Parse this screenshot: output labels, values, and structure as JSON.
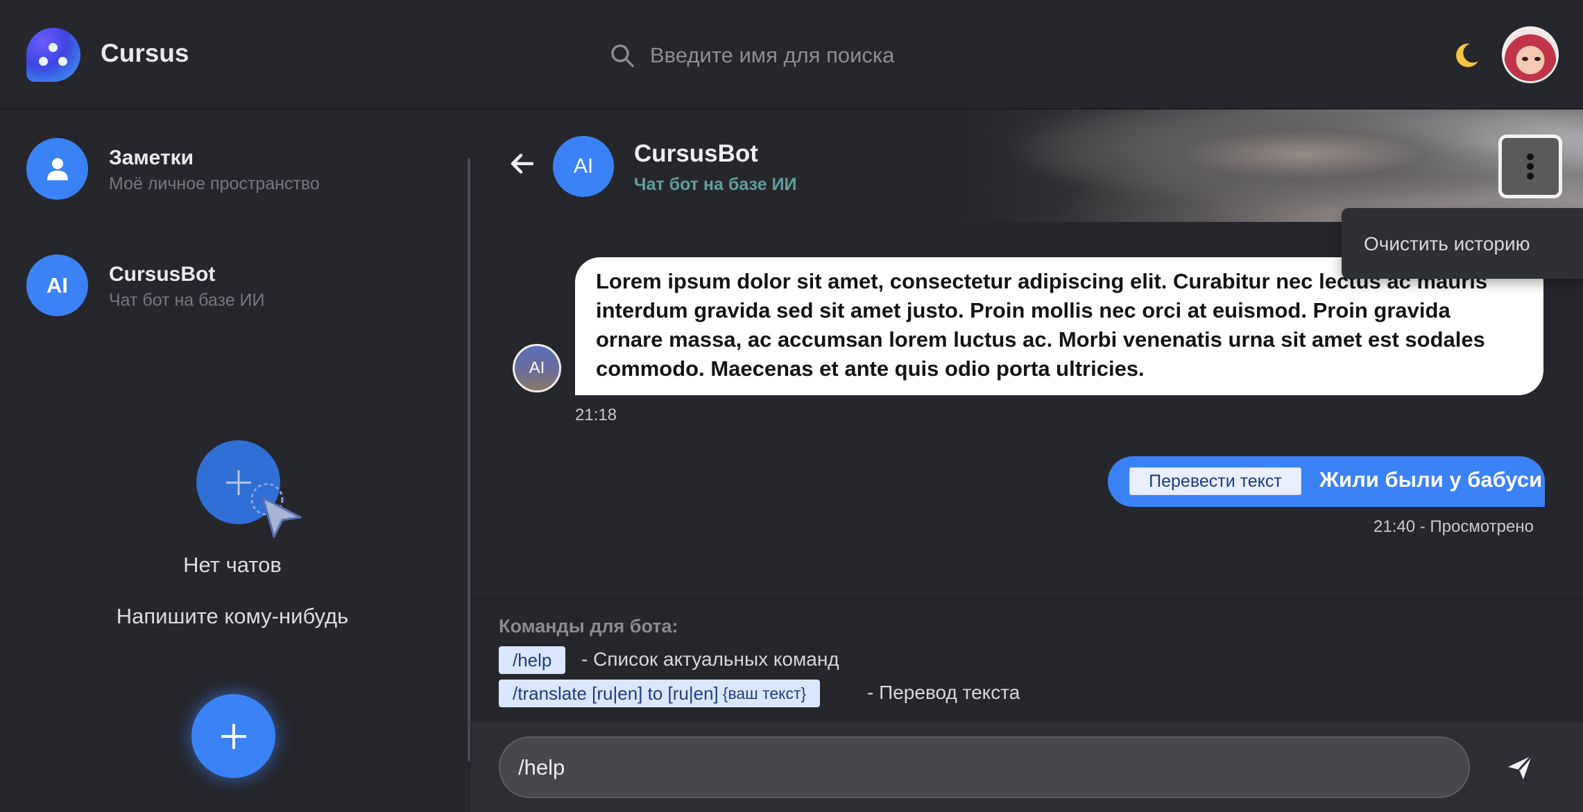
{
  "header": {
    "brand": "Cursus",
    "search_placeholder": "Введите имя для поиска"
  },
  "sidebar": {
    "items": [
      {
        "avatar_text": "",
        "name": "Заметки",
        "subtitle": "Моё личное пространство"
      },
      {
        "avatar_text": "AI",
        "name": "CursusBot",
        "subtitle": "Чат бот на базе ИИ"
      }
    ],
    "empty_title": "Нет чатов",
    "empty_subtitle": "Напишите кому-нибудь"
  },
  "chat": {
    "bot_avatar": "AI",
    "bot_name": "CursusBot",
    "bot_subtitle": "Чат бот на базе ИИ",
    "menu_items": [
      "Очистить историю"
    ],
    "messages": [
      {
        "from": "bot",
        "avatar": "AI",
        "text": "Lorem ipsum dolor sit amet, consectetur adipiscing elit. Curabitur nec lectus ac mauris interdum gravida sed sit amet justo. Proin mollis nec orci at euismod. Proin gravida ornare massa, ac accumsan lorem luctus ac. Morbi venenatis urna sit amet est sodales commodo. Maecenas et ante quis odio porta ultricies.",
        "time": "21:18"
      },
      {
        "from": "user",
        "tag": "Перевести текст",
        "text": "Жили были у бабуси",
        "time": "21:40 - Просмотрено"
      }
    ],
    "commands": {
      "title": "Команды для бота:",
      "list": [
        {
          "command": "/help",
          "arg": "",
          "description": "- Список актуальных команд"
        },
        {
          "command": "/translate [ru|en] to [ru|en]",
          "arg": "{ваш текст}",
          "description": "- Перевод текста"
        }
      ]
    },
    "input_value": "/help"
  },
  "colors": {
    "background": "#26272c",
    "accent": "#3b82f6",
    "bubble_in": "#ffffff",
    "bot_subtitle": "#5f9ea0",
    "moon": "#f5c542"
  },
  "icons": {
    "search": "search-icon",
    "theme": "moon-icon",
    "back": "arrow-left-icon",
    "menu": "more-vertical-icon",
    "add": "plus-icon",
    "send": "send-icon",
    "notes_avatar": "user-icon"
  }
}
